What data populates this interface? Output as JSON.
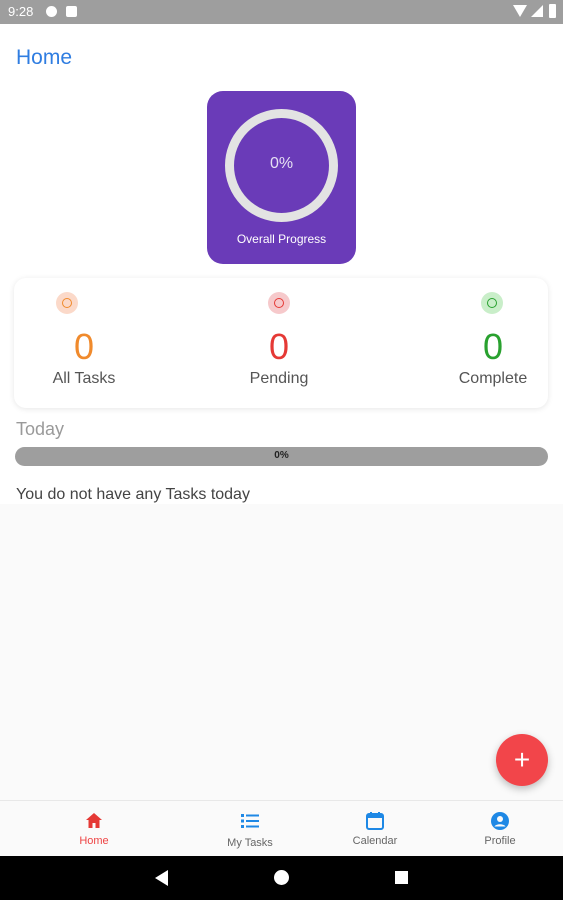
{
  "status_bar": {
    "time": "9:28"
  },
  "page": {
    "title": "Home"
  },
  "overall": {
    "percent_text": "0%",
    "label": "Overall Progress",
    "progress": 0
  },
  "stats": [
    {
      "count": "0",
      "label": "All Tasks",
      "color": "#f08a2c",
      "bg": "#fbd9c9"
    },
    {
      "count": "0",
      "label": "Pending",
      "color": "#e53935",
      "bg": "#f6c9cb"
    },
    {
      "count": "0",
      "label": "Complete",
      "color": "#29a12f",
      "bg": "#c9eec9"
    }
  ],
  "today": {
    "label": "Today",
    "percent_text": "0%",
    "progress": 0,
    "empty_message": "You do not have any Tasks today"
  },
  "fab": {
    "symbol": "+"
  },
  "bottom_nav": [
    {
      "label": "Home",
      "icon": "home-icon",
      "active": true
    },
    {
      "label": "My Tasks",
      "icon": "list-icon",
      "active": false
    },
    {
      "label": "Calendar",
      "icon": "calendar-icon",
      "active": false
    },
    {
      "label": "Profile",
      "icon": "profile-icon",
      "active": false
    }
  ],
  "colors": {
    "accent": "#2f7de1",
    "card": "#6a3bb8",
    "fab": "#f2454a",
    "nav_icon": "#1e88e5",
    "nav_active": "#e53935"
  }
}
